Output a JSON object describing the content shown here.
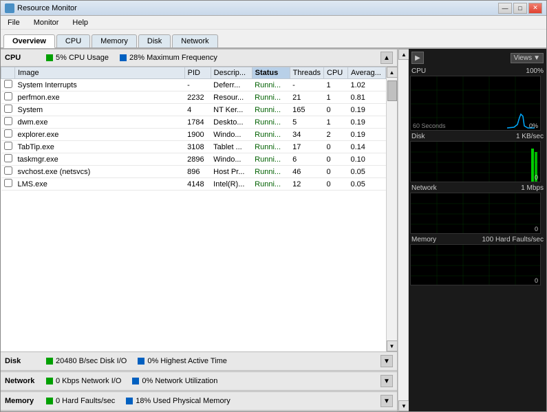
{
  "window": {
    "title": "Resource Monitor",
    "controls": {
      "minimize": "—",
      "maximize": "□",
      "close": "✕"
    }
  },
  "menubar": {
    "items": [
      "File",
      "Monitor",
      "Help"
    ]
  },
  "tabs": {
    "items": [
      "Overview",
      "CPU",
      "Memory",
      "Disk",
      "Network"
    ],
    "active": "Overview"
  },
  "cpu_section": {
    "title": "CPU",
    "stat1_dot": "green",
    "stat1": "5% CPU Usage",
    "stat2_dot": "blue",
    "stat2": "28% Maximum Frequency"
  },
  "table": {
    "columns": [
      "",
      "Image",
      "PID",
      "Descrip...",
      "Status",
      "Threads",
      "CPU",
      "Averag..."
    ],
    "rows": [
      [
        "",
        "System Interrupts",
        "-",
        "Deferr...",
        "Runni...",
        "-",
        "1",
        "1.02"
      ],
      [
        "",
        "perfmon.exe",
        "2232",
        "Resour...",
        "Runni...",
        "21",
        "1",
        "0.81"
      ],
      [
        "",
        "System",
        "4",
        "NT Ker...",
        "Runni...",
        "165",
        "0",
        "0.19"
      ],
      [
        "",
        "dwm.exe",
        "1784",
        "Deskto...",
        "Runni...",
        "5",
        "1",
        "0.19"
      ],
      [
        "",
        "explorer.exe",
        "1900",
        "Windo...",
        "Runni...",
        "34",
        "2",
        "0.19"
      ],
      [
        "",
        "TabTip.exe",
        "3108",
        "Tablet ...",
        "Runni...",
        "17",
        "0",
        "0.14"
      ],
      [
        "",
        "taskmgr.exe",
        "2896",
        "Windo...",
        "Runni...",
        "6",
        "0",
        "0.10"
      ],
      [
        "",
        "svchost.exe (netsvcs)",
        "896",
        "Host Pr...",
        "Runni...",
        "46",
        "0",
        "0.05"
      ],
      [
        "",
        "LMS.exe",
        "4148",
        "Intel(R)...",
        "Runni...",
        "12",
        "0",
        "0.05"
      ]
    ]
  },
  "disk_section": {
    "title": "Disk",
    "stat1": "20480 B/sec Disk I/O",
    "stat2": "0% Highest Active Time"
  },
  "network_section": {
    "title": "Network",
    "stat1": "0 Kbps Network I/O",
    "stat2": "0% Network Utilization"
  },
  "memory_section": {
    "title": "Memory",
    "stat1": "0 Hard Faults/sec",
    "stat2": "18% Used Physical Memory"
  },
  "graphs": {
    "cpu": {
      "label": "CPU",
      "value_top": "100%",
      "value_bottom": "0%",
      "time_label": "60 Seconds"
    },
    "disk": {
      "label": "Disk",
      "value_top": "1 KB/sec",
      "value_bottom": "0"
    },
    "network": {
      "label": "Network",
      "value_top": "1 Mbps",
      "value_bottom": "0"
    },
    "memory": {
      "label": "Memory",
      "value_top": "100 Hard Faults/sec",
      "value_bottom": "0"
    }
  },
  "views_button": "Views"
}
